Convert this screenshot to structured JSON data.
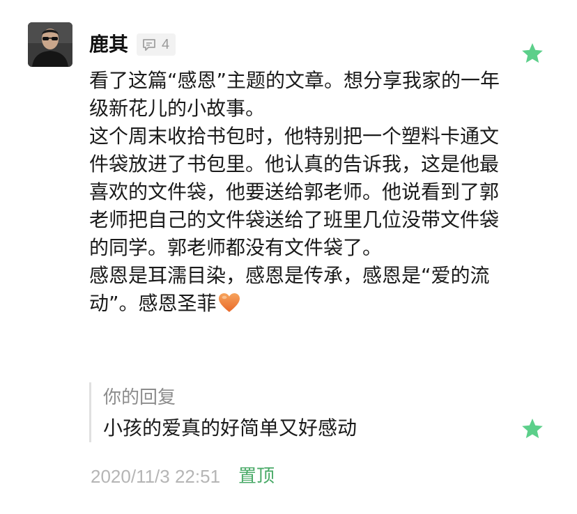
{
  "comment": {
    "author": {
      "name": "鹿其",
      "reply_count": "4",
      "avatar_icon": "user-avatar-photo"
    },
    "paragraphs": [
      "看了这篇“感恩”主题的文章。想分享我家的一年级新花儿的小故事。",
      "这个周末收拾书包时，他特别把一个塑料卡通文件袋放进了书包里。他认真的告诉我，这是他最喜欢的文件袋，他要送给郭老师。他说看到了郭老师把自己的文件袋送给了班里几位没带文件袋的同学。郭老师都没有文件袋了。",
      "感恩是耳濡目染，感恩是传承，感恩是“爱的流动”。感恩圣菲"
    ],
    "emoji": "orange-heart",
    "featured_icon": "star-icon",
    "accent_color": "#5ccf8a"
  },
  "reply": {
    "label": "你的回复",
    "text": "小孩的爱真的好简单又好感动"
  },
  "footer": {
    "timestamp": "2020/11/3 22:51",
    "pin_label": "置顶",
    "pin_color": "#4aaa68"
  }
}
